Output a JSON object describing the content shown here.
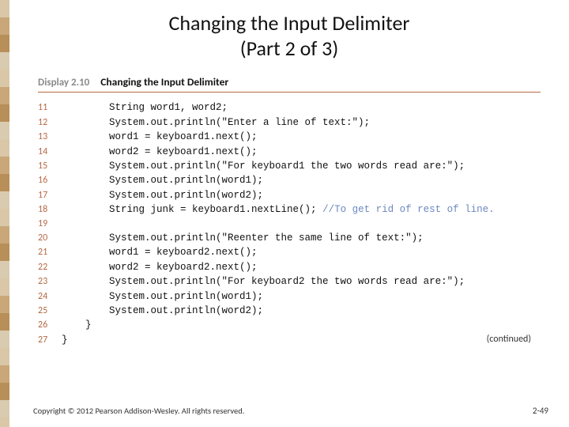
{
  "title": {
    "line1": "Changing the Input Delimiter",
    "line2": "(Part 2 of 3)"
  },
  "display": {
    "number": "Display 2.10",
    "caption": "Changing the Input Delimiter"
  },
  "code": {
    "lines": [
      {
        "num": "11",
        "indent": "        ",
        "text": "String word1, word2;",
        "comment": ""
      },
      {
        "num": "12",
        "indent": "        ",
        "text": "System.out.println(\"Enter a line of text:\");",
        "comment": ""
      },
      {
        "num": "13",
        "indent": "        ",
        "text": "word1 = keyboard1.next();",
        "comment": ""
      },
      {
        "num": "14",
        "indent": "        ",
        "text": "word2 = keyboard1.next();",
        "comment": ""
      },
      {
        "num": "15",
        "indent": "        ",
        "text": "System.out.println(\"For keyboard1 the two words read are:\");",
        "comment": ""
      },
      {
        "num": "16",
        "indent": "        ",
        "text": "System.out.println(word1);",
        "comment": ""
      },
      {
        "num": "17",
        "indent": "        ",
        "text": "System.out.println(word2);",
        "comment": ""
      },
      {
        "num": "18",
        "indent": "        ",
        "text": "String junk = keyboard1.nextLine(); ",
        "comment": "//To get rid of rest of line."
      },
      {
        "num": "19",
        "indent": "",
        "text": "",
        "comment": ""
      },
      {
        "num": "20",
        "indent": "        ",
        "text": "System.out.println(\"Reenter the same line of text:\");",
        "comment": ""
      },
      {
        "num": "21",
        "indent": "        ",
        "text": "word1 = keyboard2.next();",
        "comment": ""
      },
      {
        "num": "22",
        "indent": "        ",
        "text": "word2 = keyboard2.next();",
        "comment": ""
      },
      {
        "num": "23",
        "indent": "        ",
        "text": "System.out.println(\"For keyboard2 the two words read are:\");",
        "comment": ""
      },
      {
        "num": "24",
        "indent": "        ",
        "text": "System.out.println(word1);",
        "comment": ""
      },
      {
        "num": "25",
        "indent": "        ",
        "text": "System.out.println(word2);",
        "comment": ""
      },
      {
        "num": "26",
        "indent": "    ",
        "text": "}",
        "comment": ""
      },
      {
        "num": "27",
        "indent": "",
        "text": "}",
        "comment": ""
      }
    ]
  },
  "continued": "(continued)",
  "footer": "Copyright © 2012 Pearson Addison-Wesley. All rights reserved.",
  "page_number": "2-49"
}
